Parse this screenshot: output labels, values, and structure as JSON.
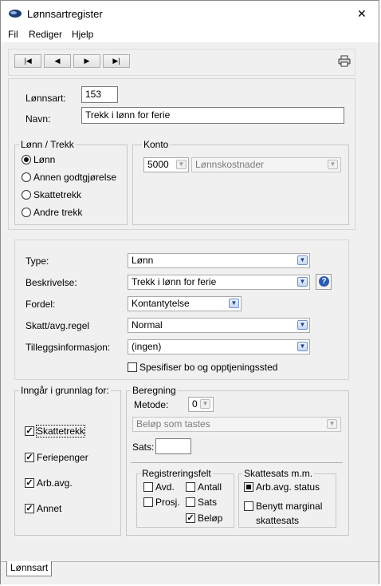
{
  "window": {
    "title": "Lønnsartregister",
    "close_glyph": "✕"
  },
  "menu": {
    "items": [
      "Fil",
      "Rediger",
      "Hjelp"
    ]
  },
  "toolbar": {
    "first": "|◀",
    "prev": "◀",
    "next": "▶",
    "last": "▶|",
    "print_icon": "printer-icon"
  },
  "header": {
    "lonnsart_label": "Lønnsart:",
    "lonnsart_value": "153",
    "navn_label": "Navn:",
    "navn_value": "Trekk i lønn for ferie"
  },
  "lonn_trekk": {
    "legend": "Lønn / Trekk",
    "options": [
      "Lønn",
      "Annen godtgjørelse",
      "Skattetrekk",
      "Andre trekk"
    ],
    "selected": "Lønn"
  },
  "konto": {
    "legend": "Konto",
    "number": "5000",
    "name": "Lønnskostnader"
  },
  "details": {
    "type_label": "Type:",
    "type_value": "Lønn",
    "beskrivelse_label": "Beskrivelse:",
    "beskrivelse_value": "Trekk i lønn for ferie",
    "help_glyph": "?",
    "fordel_label": "Fordel:",
    "fordel_value": "Kontantytelse",
    "skatt_label": "Skatt/avg.regel",
    "skatt_value": "Normal",
    "tillegg_label": "Tilleggsinformasjon:",
    "tillegg_value": "(ingen)",
    "spesifiser_label": "Spesifiser bo og opptjeningssted",
    "spesifiser_checked": false
  },
  "grunnlag": {
    "legend": "Inngår i grunnlag for:",
    "items": [
      {
        "label": "Skattetrekk",
        "checked": true
      },
      {
        "label": "Feriepenger",
        "checked": true
      },
      {
        "label": "Arb.avg.",
        "checked": true
      },
      {
        "label": "Annet",
        "checked": true
      }
    ]
  },
  "beregning": {
    "legend": "Beregning",
    "metode_label": "Metode:",
    "metode_value": "0",
    "belop_value": "Beløp som tastes",
    "sats_label": "Sats:",
    "sats_value": ""
  },
  "registreringsfelt": {
    "legend": "Registreringsfelt",
    "items": [
      {
        "label": "Avd.",
        "checked": false
      },
      {
        "label": "Antall",
        "checked": false
      },
      {
        "label": "Prosj.",
        "checked": false
      },
      {
        "label": "Sats",
        "checked": false
      },
      {
        "label": "Beløp",
        "checked": true
      }
    ]
  },
  "skattesats": {
    "legend": "Skattesats m.m.",
    "arbavg_label": "Arb.avg. status",
    "marginal_label_1": "Benytt marginal",
    "marginal_label_2": "skattesats"
  },
  "tabs": {
    "active": "Lønnsart"
  },
  "colors": {
    "accent": "#2a5bb0",
    "panel_bg": "#f0f0f0"
  }
}
